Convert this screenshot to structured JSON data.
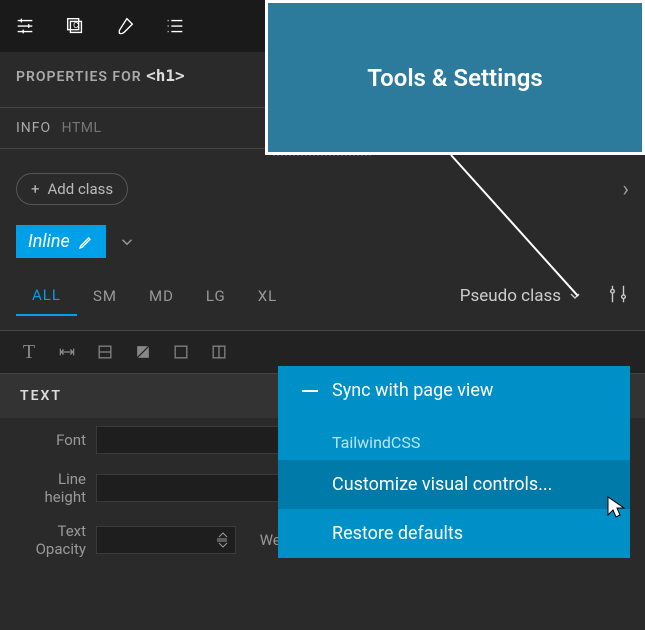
{
  "callout": {
    "title": "Tools & Settings"
  },
  "toolbar": {
    "icons": [
      "sliders",
      "copy",
      "brush",
      "list"
    ]
  },
  "properties": {
    "label": "PROPERTIES FOR",
    "tag": "<h1>"
  },
  "info": {
    "label": "INFO",
    "sub": "HTML"
  },
  "addClass": {
    "label": "Add class"
  },
  "inlineChip": {
    "label": "Inline"
  },
  "breakpoints": {
    "items": [
      "ALL",
      "SM",
      "MD",
      "LG",
      "XL"
    ],
    "active": 0
  },
  "pseudo": {
    "label": "Pseudo class"
  },
  "textSection": {
    "header": "TEXT"
  },
  "props": {
    "font_label": "Font",
    "line_height_label": "Line height",
    "text_label": "Text",
    "opacity_label": "Opacity",
    "weight_label": "Weight"
  },
  "dropdown": {
    "sync": "Sync with page view",
    "tailwind": "TailwindCSS",
    "customize": "Customize visual controls...",
    "restore": "Restore defaults"
  }
}
